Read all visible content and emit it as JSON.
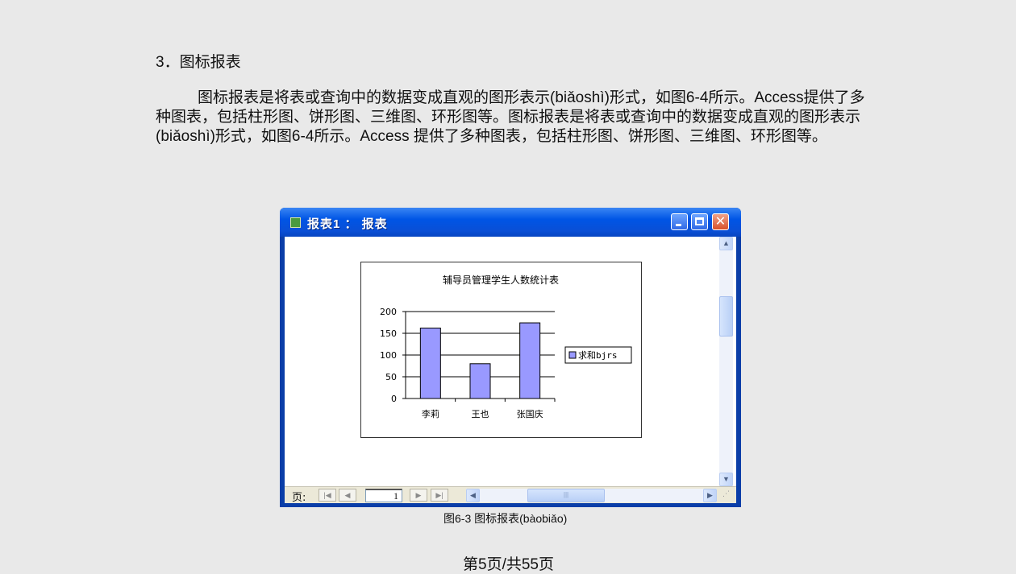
{
  "heading": "3．图标报表",
  "paragraph": "图标报表是将表或查询中的数据变成直观的图形表示(biǎoshì)形式，如图6-4所示。Access提供了多种图表，包括柱形图、饼形图、三维图、环形图等。图标报表是将表或查询中的数据变成直观的图形表示(biǎoshì)形式，如图6-4所示。Access 提供了多种图表，包括柱形图、饼形图、三维图、环形图等。",
  "window": {
    "title": "报表1 ： 报表",
    "close_glyph": "✕",
    "status": {
      "page_label": "页:",
      "page_value": "1",
      "first": "|◀",
      "prev": "◀",
      "next": "▶",
      "last": "▶|"
    }
  },
  "chart_data": {
    "type": "bar",
    "title": "辅导员管理学生人数统计表",
    "categories": [
      "李莉",
      "王也",
      "张国庆"
    ],
    "series": [
      {
        "name": "求和bjrs",
        "values": [
          162,
          80,
          174
        ],
        "color": "#9999ff"
      }
    ],
    "ylim": [
      0,
      200
    ],
    "yticks": [
      0,
      50,
      100,
      150,
      200
    ],
    "grid": true,
    "legend": "right"
  },
  "caption": "图6-3  图标报表(bàobiǎo)",
  "footer": "第5页/共55页"
}
